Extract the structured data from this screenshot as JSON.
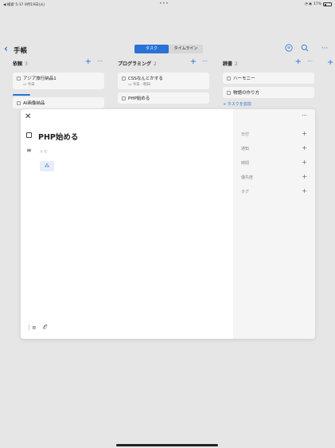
{
  "status": {
    "back_app": "◀ 検索",
    "time_date": "5:37  9月19日(火)",
    "dots": "•••",
    "battery_pct": "17%"
  },
  "header": {
    "title": "手帳",
    "tabs": [
      "タスク",
      "タイムライン"
    ]
  },
  "columns": [
    {
      "name": "依頼",
      "count": "3",
      "cards": [
        {
          "title": "アジア旅行納品1",
          "date": "今日"
        },
        {
          "title": "AI画像納品",
          "date": ""
        }
      ]
    },
    {
      "name": "プログラミング",
      "count": "2",
      "cards": [
        {
          "title": "CSSなんとかする",
          "date": "今日 - 明日"
        },
        {
          "title": "PHP始める",
          "date": ""
        }
      ]
    },
    {
      "name": "読書",
      "count": "2",
      "cards": [
        {
          "title": "ハーモニー",
          "date": ""
        },
        {
          "title": "物語の作り方",
          "date": ""
        }
      ],
      "add_label": "+ タスクを追加"
    }
  ],
  "modal": {
    "task_title": "PHP始める",
    "memo_placeholder": "メモ",
    "properties": [
      "日付",
      "通知",
      "時間",
      "優先度",
      "タグ"
    ]
  }
}
